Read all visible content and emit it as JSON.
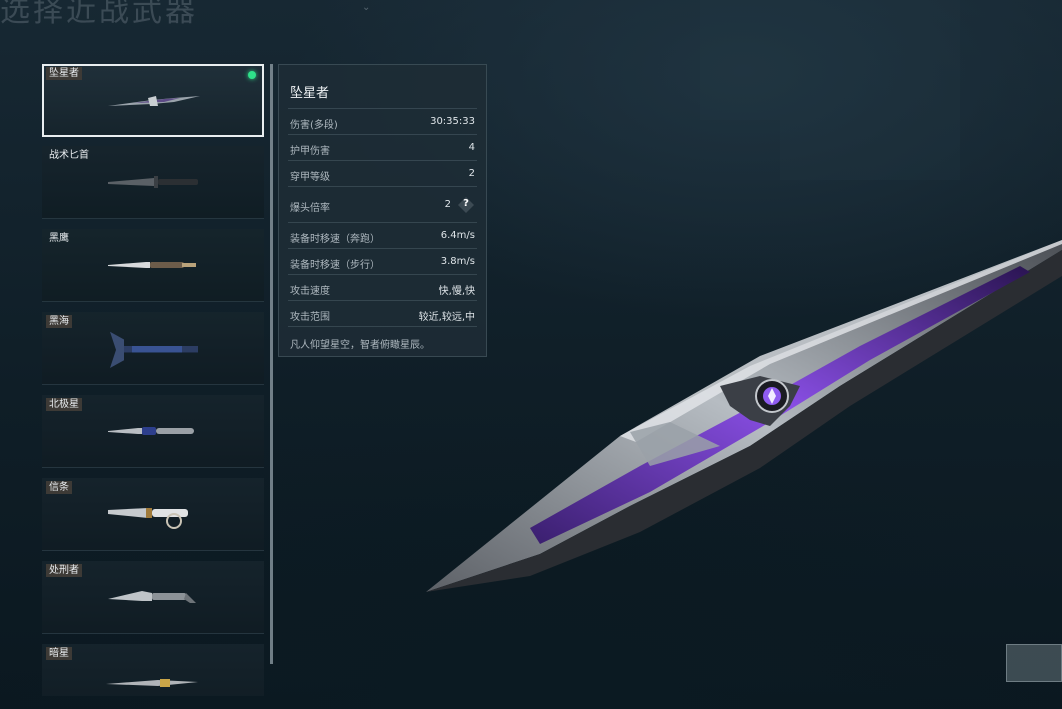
{
  "page_title": "选择近战武器",
  "weapon_list": {
    "selected_index": 0,
    "items": [
      {
        "name": "坠星者",
        "tagged": true,
        "equipped": true,
        "icon": "falling-star-knife-icon"
      },
      {
        "name": "战术匕首",
        "tagged": false,
        "equipped": false,
        "icon": "tactical-dagger-icon"
      },
      {
        "name": "黑鹰",
        "tagged": false,
        "equipped": false,
        "icon": "black-hawk-knife-icon"
      },
      {
        "name": "黑海",
        "tagged": true,
        "equipped": false,
        "icon": "black-sea-axe-icon"
      },
      {
        "name": "北极星",
        "tagged": true,
        "equipped": false,
        "icon": "polaris-knife-icon"
      },
      {
        "name": "信条",
        "tagged": true,
        "equipped": false,
        "icon": "creed-knife-icon"
      },
      {
        "name": "处刑者",
        "tagged": true,
        "equipped": false,
        "icon": "executioner-knife-icon"
      },
      {
        "name": "暗星",
        "tagged": true,
        "equipped": false,
        "icon": "dark-star-knife-icon"
      }
    ]
  },
  "stats": {
    "title": "坠星者",
    "rows": [
      {
        "label": "伤害(多段)",
        "value": "30:35:33"
      },
      {
        "label": "护甲伤害",
        "value": "4"
      },
      {
        "label": "穿甲等级",
        "value": "2"
      },
      {
        "label": "爆头倍率",
        "value": "2",
        "help": "?"
      },
      {
        "label": "装备时移速（奔跑）",
        "value": "6.4m/s"
      },
      {
        "label": "装备时移速（步行）",
        "value": "3.8m/s"
      },
      {
        "label": "攻击速度",
        "value": "快,慢,快"
      },
      {
        "label": "攻击范围",
        "value": "较近,较远,中"
      }
    ],
    "flavor": "凡人仰望星空，智者俯瞰星辰。"
  },
  "colors": {
    "equipped_dot": "#2fe08a",
    "blade_purple": "#7a3fd0",
    "selected_border": "#e9eef0"
  }
}
